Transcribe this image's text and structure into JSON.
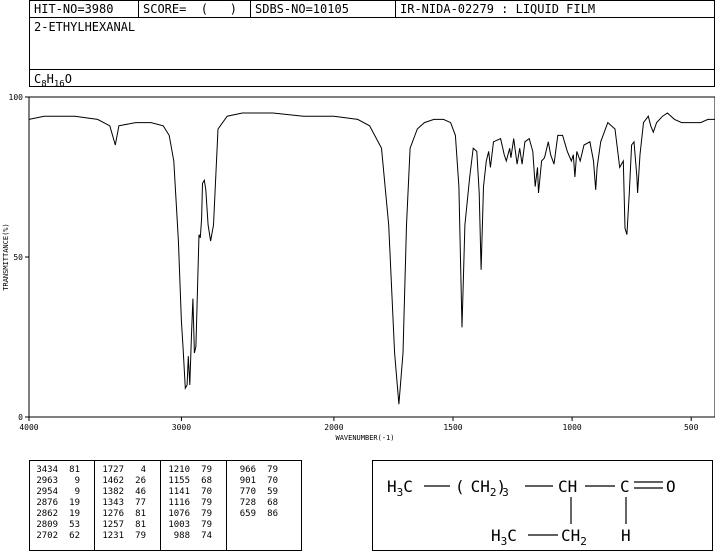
{
  "header": {
    "hit_no": "HIT-NO=3980",
    "score": "SCORE=  (   )",
    "sdbs_no": "SDBS-NO=10105",
    "ir_no": "IR-NIDA-02279 : LIQUID FILM"
  },
  "compound": {
    "name": "2-ETHYLHEXANAL",
    "formula_main": "C",
    "formula_c": "8",
    "formula_h_letter": "H",
    "formula_h": "16",
    "formula_o": "O"
  },
  "chart_data": {
    "type": "line",
    "xlabel": "WAVENUMBER(-1)",
    "ylabel": "TRANSMITTANCE(%)",
    "xlim": [
      4000,
      400
    ],
    "ylim": [
      0,
      100
    ],
    "x_ticks": [
      4000,
      3000,
      2000,
      1500,
      1000,
      500
    ],
    "y_ticks": [
      0,
      50,
      100
    ],
    "x_tick_labels": [
      "4000",
      "3000",
      "2000",
      "1500",
      "1000",
      "500"
    ],
    "y_tick_labels": [
      "0",
      "50",
      "100"
    ],
    "series": [
      {
        "points": [
          [
            4000,
            93
          ],
          [
            3900,
            94
          ],
          [
            3700,
            94
          ],
          [
            3550,
            93
          ],
          [
            3470,
            91
          ],
          [
            3434,
            85
          ],
          [
            3410,
            91
          ],
          [
            3300,
            92
          ],
          [
            3200,
            92
          ],
          [
            3120,
            91
          ],
          [
            3080,
            88
          ],
          [
            3050,
            80
          ],
          [
            3020,
            55
          ],
          [
            3000,
            30
          ],
          [
            2990,
            22
          ],
          [
            2975,
            9
          ],
          [
            2963,
            10
          ],
          [
            2955,
            19
          ],
          [
            2945,
            10
          ],
          [
            2935,
            25
          ],
          [
            2925,
            37
          ],
          [
            2915,
            20
          ],
          [
            2905,
            22
          ],
          [
            2895,
            40
          ],
          [
            2885,
            57
          ],
          [
            2876,
            56
          ],
          [
            2868,
            62
          ],
          [
            2862,
            73
          ],
          [
            2850,
            74
          ],
          [
            2840,
            71
          ],
          [
            2825,
            60
          ],
          [
            2809,
            55
          ],
          [
            2790,
            60
          ],
          [
            2760,
            90
          ],
          [
            2700,
            94
          ],
          [
            2600,
            95
          ],
          [
            2400,
            95
          ],
          [
            2200,
            94
          ],
          [
            2000,
            94
          ],
          [
            1900,
            93
          ],
          [
            1850,
            91
          ],
          [
            1800,
            84
          ],
          [
            1770,
            60
          ],
          [
            1745,
            20
          ],
          [
            1727,
            4
          ],
          [
            1710,
            20
          ],
          [
            1695,
            60
          ],
          [
            1680,
            84
          ],
          [
            1650,
            90
          ],
          [
            1620,
            92
          ],
          [
            1580,
            93
          ],
          [
            1540,
            93
          ],
          [
            1510,
            92
          ],
          [
            1490,
            88
          ],
          [
            1475,
            72
          ],
          [
            1462,
            28
          ],
          [
            1450,
            60
          ],
          [
            1430,
            75
          ],
          [
            1415,
            84
          ],
          [
            1400,
            83
          ],
          [
            1390,
            70
          ],
          [
            1382,
            46
          ],
          [
            1372,
            72
          ],
          [
            1360,
            80
          ],
          [
            1350,
            83
          ],
          [
            1343,
            78
          ],
          [
            1330,
            86
          ],
          [
            1300,
            87
          ],
          [
            1285,
            82
          ],
          [
            1276,
            80
          ],
          [
            1262,
            84
          ],
          [
            1257,
            81
          ],
          [
            1245,
            87
          ],
          [
            1231,
            79
          ],
          [
            1220,
            84
          ],
          [
            1210,
            79
          ],
          [
            1198,
            86
          ],
          [
            1180,
            87
          ],
          [
            1165,
            83
          ],
          [
            1155,
            72
          ],
          [
            1145,
            78
          ],
          [
            1141,
            70
          ],
          [
            1128,
            80
          ],
          [
            1116,
            81
          ],
          [
            1100,
            86
          ],
          [
            1090,
            82
          ],
          [
            1076,
            79
          ],
          [
            1060,
            88
          ],
          [
            1040,
            88
          ],
          [
            1020,
            83
          ],
          [
            1003,
            80
          ],
          [
            995,
            82
          ],
          [
            988,
            75
          ],
          [
            980,
            83
          ],
          [
            966,
            80
          ],
          [
            950,
            85
          ],
          [
            925,
            86
          ],
          [
            910,
            80
          ],
          [
            901,
            71
          ],
          [
            895,
            78
          ],
          [
            880,
            86
          ],
          [
            850,
            92
          ],
          [
            820,
            90
          ],
          [
            800,
            78
          ],
          [
            785,
            80
          ],
          [
            778,
            59
          ],
          [
            770,
            57
          ],
          [
            760,
            70
          ],
          [
            750,
            85
          ],
          [
            740,
            86
          ],
          [
            728,
            75
          ],
          [
            725,
            70
          ],
          [
            715,
            82
          ],
          [
            700,
            92
          ],
          [
            680,
            94
          ],
          [
            670,
            91
          ],
          [
            659,
            89
          ],
          [
            645,
            92
          ],
          [
            620,
            94
          ],
          [
            600,
            95
          ],
          [
            570,
            93
          ],
          [
            540,
            92
          ],
          [
            500,
            92
          ],
          [
            460,
            92
          ],
          [
            430,
            93
          ],
          [
            400,
            93
          ]
        ]
      }
    ]
  },
  "peak_table": {
    "columns": [
      [
        [
          "3434",
          "81"
        ],
        [
          "2963",
          "9"
        ],
        [
          "2954",
          "9"
        ],
        [
          "2876",
          "19"
        ],
        [
          "2862",
          "19"
        ],
        [
          "2809",
          "53"
        ],
        [
          "2702",
          "62"
        ]
      ],
      [
        [
          "1727",
          "4"
        ],
        [
          "1462",
          "26"
        ],
        [
          "1382",
          "46"
        ],
        [
          "1343",
          "77"
        ],
        [
          "1276",
          "81"
        ],
        [
          "1257",
          "81"
        ],
        [
          "1231",
          "79"
        ]
      ],
      [
        [
          "1210",
          "79"
        ],
        [
          "1155",
          "68"
        ],
        [
          "1141",
          "70"
        ],
        [
          "1116",
          "79"
        ],
        [
          "1076",
          "79"
        ],
        [
          "1003",
          "79"
        ],
        [
          "988",
          "74"
        ]
      ],
      [
        [
          "966",
          "79"
        ],
        [
          "901",
          "70"
        ],
        [
          "770",
          "59"
        ],
        [
          "728",
          "68"
        ],
        [
          "659",
          "86"
        ]
      ]
    ]
  },
  "structure": {
    "h3c_top": "H",
    "h3c_top_sub": "3",
    "h3c_top_c": "C",
    "chain_open": "(",
    "chain_ch": "CH",
    "chain_sub": "2",
    "chain_close": ")",
    "chain_repeat": "3",
    "ch": "CH",
    "c_carbonyl": "C",
    "o": "O",
    "h3c_bottom": "H",
    "h3c_bottom_sub": "3",
    "h3c_bottom_c": "C",
    "ch2_bottom": "CH",
    "ch2_bottom_sub": "2",
    "h_aldehyde": "H"
  }
}
